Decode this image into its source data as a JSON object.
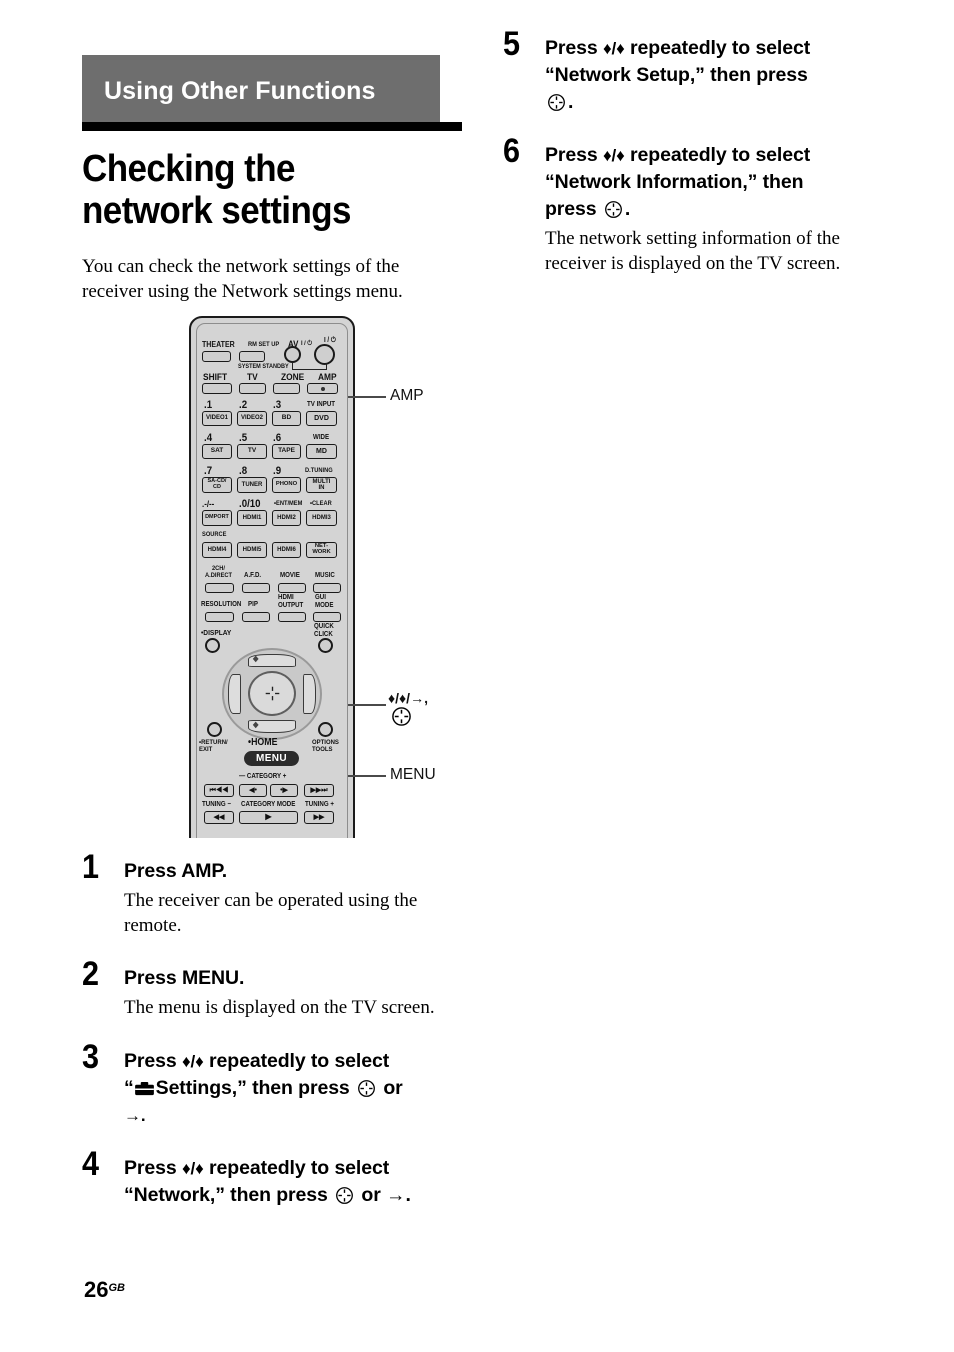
{
  "chapter": {
    "band_title": "Using Other Functions"
  },
  "article": {
    "title": "Checking the network settings",
    "intro": "You can check the network settings of the receiver using the Network settings menu."
  },
  "steps": [
    {
      "num": "1",
      "head_plain": "Press AMP.",
      "body": "The receiver can be operated using the remote."
    },
    {
      "num": "2",
      "head_plain": "Press MENU.",
      "body": "The menu is displayed on the TV screen."
    },
    {
      "num": "3",
      "head_a": "Press ",
      "arrows": "♦/♦",
      "head_b": " repeatedly to select",
      "head_c": "“",
      "settings_label": "Settings,” then press ",
      "head_d": " or",
      "head_e": "→.",
      "body": ""
    },
    {
      "num": "4",
      "head_a": "Press ",
      "arrows": "♦/♦",
      "head_b": " repeatedly to select",
      "head_c": "“Network,” then press ",
      "head_d": " or →.",
      "body": ""
    },
    {
      "num": "5",
      "head_a": "Press ",
      "arrows": "♦/♦",
      "head_b": " repeatedly to select",
      "head_c": "“Network Setup,” then press",
      "head_d": ".",
      "body": ""
    },
    {
      "num": "6",
      "head_a": "Press ",
      "arrows": "♦/♦",
      "head_b": " repeatedly to select",
      "head_c": "“Network Information,” then",
      "head_d": "press ",
      "head_e": ".",
      "body": "The network setting information of the receiver is displayed on the TV screen."
    }
  ],
  "figure": {
    "callouts": [
      {
        "name": "amp",
        "text": "AMP"
      },
      {
        "name": "nav",
        "text": "♦/♦/→,"
      },
      {
        "name": "menu",
        "text": "MENU"
      }
    ],
    "remote": {
      "top_labels": [
        "THEATER",
        "RM SET UP",
        "AV",
        "SYSTEM STANDBY"
      ],
      "power_av": "I / ⏻",
      "power_amp": "I / ⏻",
      "mode_row": [
        "SHIFT",
        "TV",
        "ZONE",
        "AMP"
      ],
      "num_labels_r1": [
        ".1",
        ".2",
        ".3",
        "TV INPUT"
      ],
      "num_btns_r1": [
        "VIDEO1",
        "VIDEO2",
        "BD",
        "DVD"
      ],
      "num_labels_r2": [
        ".4",
        ".5",
        ".6",
        "WIDE"
      ],
      "num_btns_r2": [
        "SAT",
        "TV",
        "TAPE",
        "MD"
      ],
      "num_labels_r3": [
        ".7",
        ".8",
        ".9",
        "D.TUNING"
      ],
      "num_btns_r3": [
        "SA-CD/\nCD",
        "TUNER",
        "PHONO",
        "MULTI\nIN"
      ],
      "num_labels_r4": [
        ".-/--",
        ".0/10",
        "•ENT/MEM",
        "•CLEAR"
      ],
      "num_btns_r4": [
        "DMPORT",
        "HDMI1",
        "HDMI2",
        "HDMI3"
      ],
      "source_label": "SOURCE",
      "source_btns": [
        "HDMI4",
        "HDMI5",
        "HDMI6",
        "NET-\nWORK"
      ],
      "field_labels_r1": [
        "2CH/\nA.DIRECT",
        "A.F.D.",
        "MOVIE",
        "MUSIC"
      ],
      "field_labels_r2": [
        "RESOLUTION",
        "PIP",
        "HDMI\nOUTPUT",
        "GUI\nMODE"
      ],
      "display_label": "•DISPLAY",
      "quick_click_label": "QUICK\nCLICK",
      "return_label": "•RETURN/\nEXIT",
      "home_label": "•HOME",
      "menu_btn": "MENU",
      "options_label": "OPTIONS\nTOOLS",
      "category_label": "— CATEGORY +",
      "transport": [
        "⏮◀◀",
        "◀•",
        "•▶",
        "▶▶⏭"
      ],
      "tuning_minus": "TUNING −",
      "category_mode": "CATEGORY MODE",
      "tuning_plus": "TUNING +"
    }
  },
  "footer": {
    "page": "26",
    "region": "GB"
  }
}
